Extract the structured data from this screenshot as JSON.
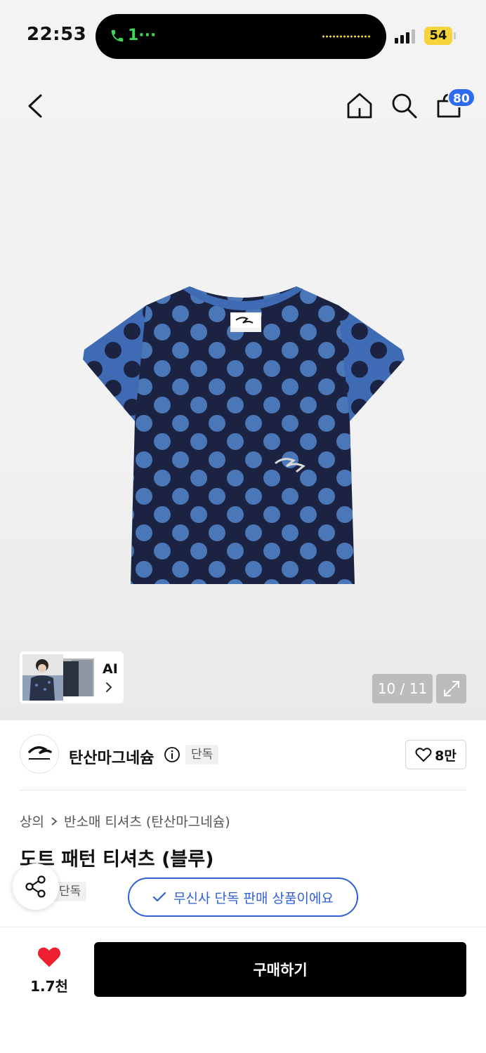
{
  "status_bar": {
    "time": "22:53",
    "call_label": "1···",
    "battery": "54"
  },
  "header": {
    "back_icon": "chevron-left-icon",
    "home_icon": "home-icon",
    "search_icon": "search-icon",
    "cart_icon": "shopping-bag-icon",
    "cart_badge": "80",
    "badge_color": "#2f6bf0"
  },
  "gallery": {
    "product_image": "navy polka dot t-shirt with blue sleeves",
    "ai_label": "AI",
    "pager": "10 / 11",
    "expand_icon": "expand-icon"
  },
  "brand": {
    "name": "탄산마그네슘",
    "exclusive_tag": "단독",
    "like_count": "8만"
  },
  "product": {
    "breadcrumb": [
      "상의",
      "반소매 티셔츠 (탄산마그네슘)"
    ],
    "title": "도트 패턴 티셔츠 (블루)",
    "exclusive_tag": "단독",
    "notice": "무신사 단독 판매 상품이에요",
    "accent_color": "#2f5fd6"
  },
  "bottom_bar": {
    "heart_count": "1.7천",
    "buy_label": "구매하기",
    "heart_color": "#ee1f2f"
  }
}
